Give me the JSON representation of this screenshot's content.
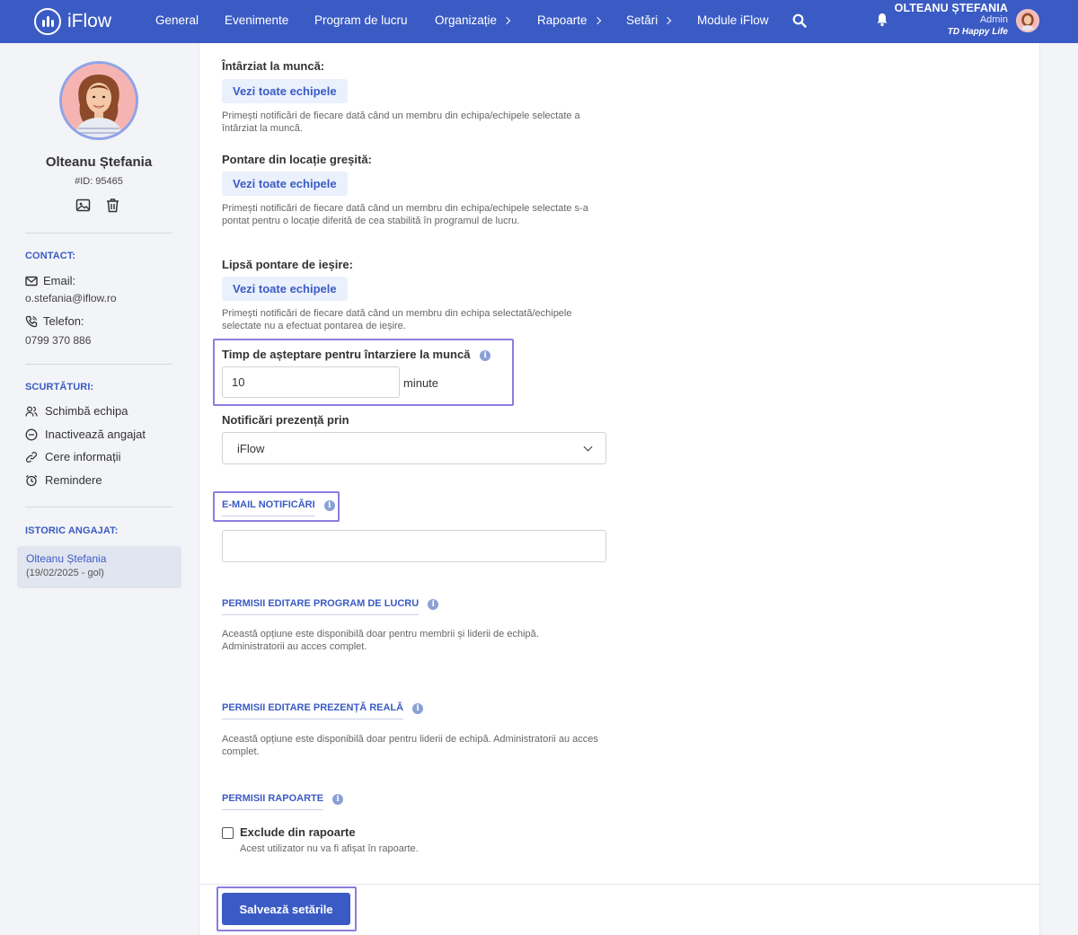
{
  "app": {
    "logo_text": "iFlow"
  },
  "nav": {
    "items": [
      {
        "label": "General"
      },
      {
        "label": "Evenimente"
      },
      {
        "label": "Program de lucru"
      },
      {
        "label": "Organizație"
      },
      {
        "label": "Rapoarte"
      },
      {
        "label": "Setări"
      },
      {
        "label": "Module iFlow"
      }
    ]
  },
  "user": {
    "name": "OLTEANU ȘTEFANIA",
    "role": "Admin",
    "team": "TD Happy Life"
  },
  "profile": {
    "name": "Olteanu Ștefania",
    "id": "#ID: 95465"
  },
  "contact": {
    "heading": "CONTACT:",
    "email_label": "Email:",
    "email": "o.stefania@iflow.ro",
    "phone_label": "Telefon:",
    "phone": "0799 370 886"
  },
  "shortcuts": {
    "heading": "SCURTĂTURI:",
    "items": [
      {
        "label": "Schimbă echipa"
      },
      {
        "label": "Inactivează angajat"
      },
      {
        "label": "Cere informații"
      },
      {
        "label": "Remindere"
      }
    ]
  },
  "history": {
    "heading": "ISTORIC ANGAJAT:",
    "name": "Olteanu Ștefania",
    "period": "(19/02/2025 - gol)"
  },
  "notifications": [
    {
      "title": "Întârziat la muncă:",
      "button": "Vezi toate echipele",
      "description": "Primești notificări de fiecare dată când un membru din echipa/echipele selectate a întârziat la muncă."
    },
    {
      "title": "Pontare din locație greșită:",
      "button": "Vezi toate echipele",
      "description": "Primești notificări de fiecare dată când un membru din echipa/echipele selectate s-a pontat pentru o locație diferită de cea stabilită în programul de lucru."
    },
    {
      "title": "Lipsă pontare de ieșire:",
      "button": "Vezi toate echipele",
      "description": "Primești notificări de fiecare dată când un membru din echipa selectată/echipele selectate nu a efectuat pontarea de ieșire."
    }
  ],
  "wait_time": {
    "label": "Timp de așteptare pentru întarziere la muncă",
    "value": "10",
    "unit": "minute"
  },
  "presence_via": {
    "label": "Notificări prezență prin",
    "selected": "iFlow"
  },
  "email_notifications": {
    "heading": "E-MAIL NOTIFICĂRI",
    "value": ""
  },
  "schedule_permissions": {
    "heading": "PERMISII EDITARE PROGRAM DE LUCRU",
    "description": "Această opțiune este disponibilă doar pentru membrii și liderii de echipă. Administratorii au acces complet."
  },
  "presence_permissions": {
    "heading": "PERMISII EDITARE PREZENȚĂ REALĂ",
    "description": "Această opțiune este disponibilă doar pentru liderii de echipă. Administratorii au acces complet."
  },
  "report_permissions": {
    "heading": "PERMISII RAPOARTE",
    "exclude_label": "Exclude din rapoarte",
    "exclude_description": "Acest utilizator nu va fi afișat în rapoarte.",
    "exclude_checked": false
  },
  "save_button": "Salvează setările",
  "colors": {
    "primary": "#3b5bc4",
    "highlight": "#8b7de0",
    "button_bg": "#eaf1fd"
  }
}
